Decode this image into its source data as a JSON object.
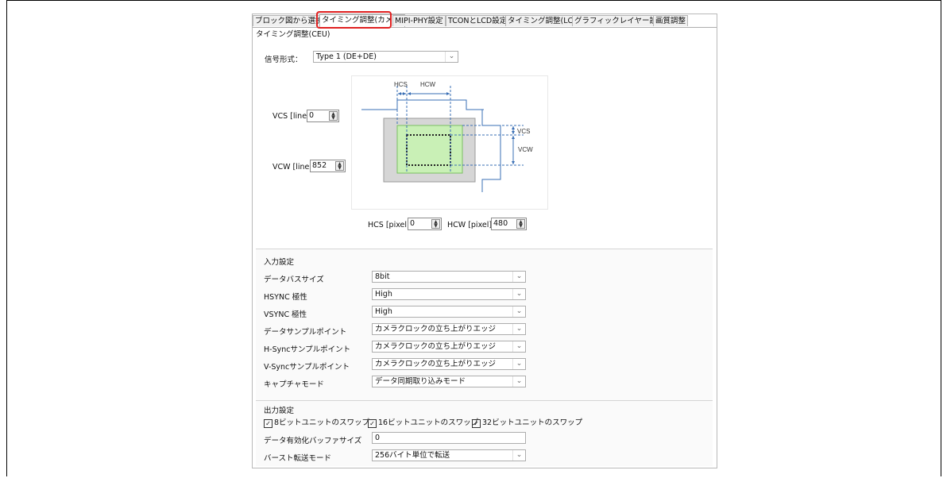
{
  "tabs": [
    {
      "label": "ブロック図から選択"
    },
    {
      "label": "タイミング調整(カメラ)"
    },
    {
      "label": "MIPI-PHY設定"
    },
    {
      "label": "TCONとLCD設定"
    },
    {
      "label": "タイミング調整(LCD)"
    },
    {
      "label": "グラフィックレイヤー設定"
    },
    {
      "label": "画質調整"
    }
  ],
  "active_tab_index": 1,
  "highlight_color": "#e02020",
  "timing": {
    "section_title": "タイミング調整(CEU)",
    "signal_format_label": "信号形式：",
    "signal_format_value": "Type 1 (DE+DE)",
    "vcs_label": "VCS [line]",
    "vcs_value": "0",
    "vcw_label": "VCW [line]",
    "vcw_value": "852",
    "hcs_label": "HCS [pixel]",
    "hcs_value": "0",
    "hcw_label": "HCW [pixel]",
    "hcw_value": "480",
    "diagram_labels": {
      "hcs": "HCS",
      "hcw": "HCW",
      "vcs": "VCS",
      "vcw": "VCW"
    }
  },
  "input_settings": {
    "title": "入力設定",
    "rows": [
      {
        "label": "データバスサイズ",
        "value": "8bit"
      },
      {
        "label": "HSYNC 極性",
        "value": "High"
      },
      {
        "label": "VSYNC 極性",
        "value": "High"
      },
      {
        "label": "データサンプルポイント",
        "value": "カメラクロックの立ち上がりエッジ"
      },
      {
        "label": "H-Syncサンプルポイント",
        "value": "カメラクロックの立ち上がりエッジ"
      },
      {
        "label": "V-Syncサンプルポイント",
        "value": "カメラクロックの立ち上がりエッジ"
      },
      {
        "label": "キャプチャモード",
        "value": "データ同期取り込みモード"
      }
    ]
  },
  "output_settings": {
    "title": "出力設定",
    "checkboxes": [
      {
        "label": "8ビットユニットのスワップ",
        "checked": true
      },
      {
        "label": "16ビットユニットのスワップ",
        "checked": true
      },
      {
        "label": "32ビットユニットのスワップ",
        "checked": true
      }
    ],
    "buffer_label": "データ有効化バッファサイズ",
    "buffer_value": "0",
    "burst_label": "バースト転送モード",
    "burst_value": "256バイト単位で転送"
  }
}
